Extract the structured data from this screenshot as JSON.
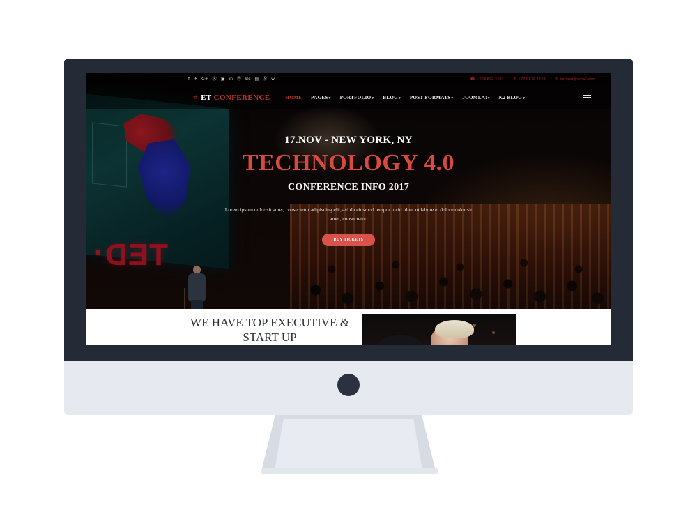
{
  "topbar": {
    "socials": [
      {
        "name": "facebook-icon",
        "glyph": "f"
      },
      {
        "name": "twitter-icon",
        "glyph": "✈"
      },
      {
        "name": "google-plus-icon",
        "glyph": "G+"
      },
      {
        "name": "pinterest-icon",
        "glyph": "Ⓟ"
      },
      {
        "name": "instagram-icon",
        "glyph": "▣"
      },
      {
        "name": "linkedin-icon",
        "glyph": "in"
      },
      {
        "name": "tumblr-icon",
        "glyph": "Ⓣ"
      },
      {
        "name": "behance-icon",
        "glyph": "Bє"
      },
      {
        "name": "flickr-icon",
        "glyph": "▤"
      },
      {
        "name": "skype-icon",
        "glyph": "Ⓢ"
      },
      {
        "name": "vk-icon",
        "glyph": "w"
      }
    ],
    "phone1": "+228 872 4444",
    "phone2": "+773 872 4444",
    "email": "contact@email.com",
    "phone_icon": "☎",
    "mobile_icon": "✆",
    "mail_icon": "✉"
  },
  "nav": {
    "logo_mark": "☣",
    "logo_primary": "ET ",
    "logo_secondary": "CONFERENCE",
    "menu": [
      {
        "label": "HOME",
        "caret": "",
        "active": true
      },
      {
        "label": "PAGES",
        "caret": "▾",
        "active": false
      },
      {
        "label": "PORTFOLIO",
        "caret": "▾",
        "active": false
      },
      {
        "label": "BLOG",
        "caret": "▾",
        "active": false
      },
      {
        "label": "POST FORMATS",
        "caret": "▾",
        "active": false
      },
      {
        "label": "JOOMLA!",
        "caret": "▾",
        "active": false
      },
      {
        "label": "K2 BLOG",
        "caret": "▾",
        "active": false
      }
    ],
    "hamburger_label": "menu-toggle"
  },
  "hero": {
    "kicker": "17.NOV - NEW YORK, NY",
    "title": "TECHNOLOGY 4.0",
    "subtitle": "CONFERENCE INFO 2017",
    "description": "Lorem ipsum dolor sit amet, consectetur adipiscing elit,sed do eiusmod tempor incid idunt ut labore et dolore,dolor sit amet, consectetur.",
    "button_label": "BUY TICKETS",
    "stage_brand": "TED"
  },
  "white_section": {
    "heading": "WE HAVE TOP EXECUTIVE & START UP"
  },
  "colors": {
    "accent_red": "#c0392f",
    "button_red": "#d9534a",
    "title_red": "#d84a3f",
    "bezel_dark": "#242a36",
    "chin_light": "#e6eaf0"
  }
}
